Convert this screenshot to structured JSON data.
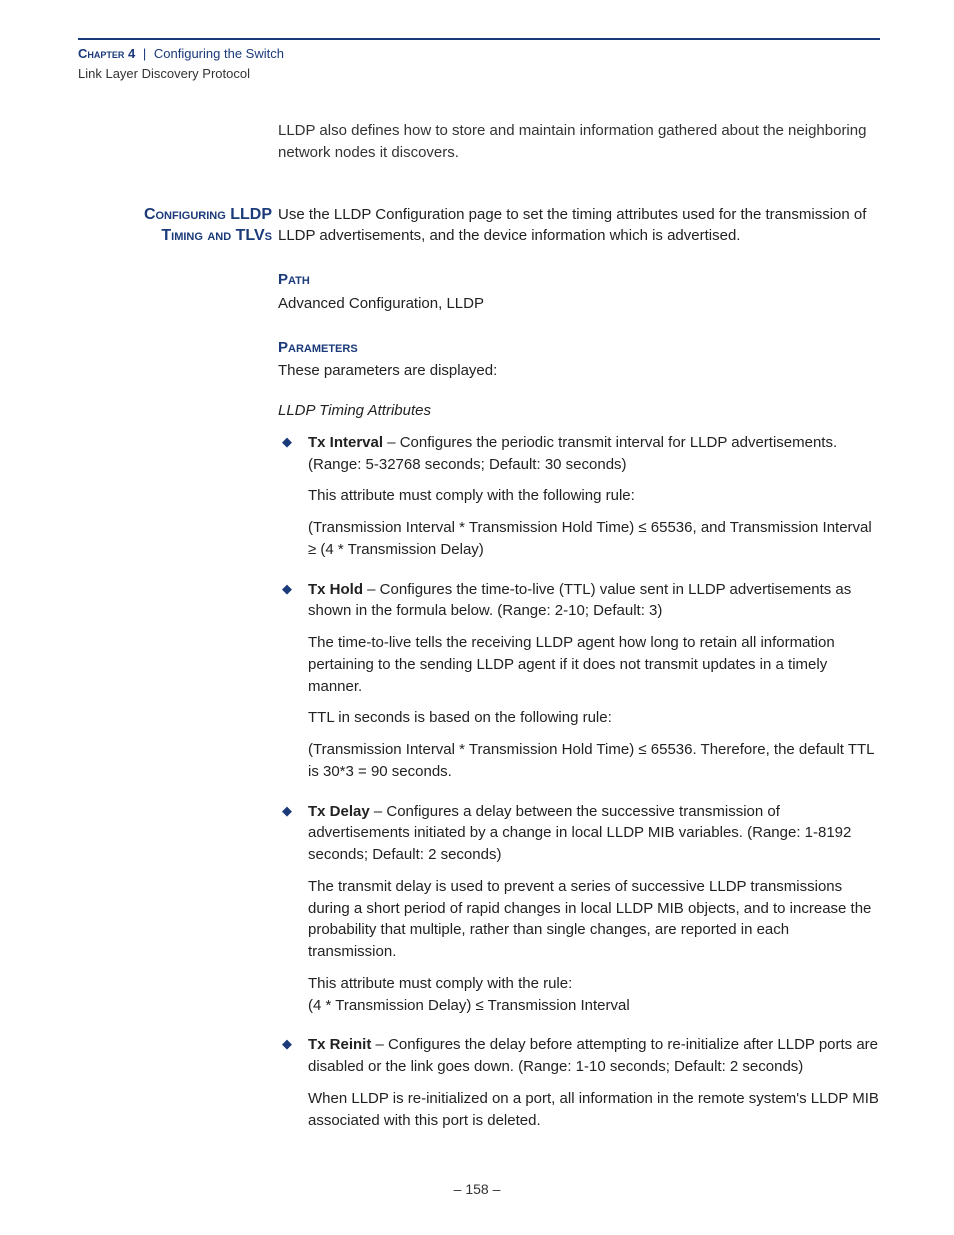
{
  "header": {
    "chapter_label": "Chapter 4",
    "separator": "|",
    "chapter_title": "Configuring the Switch",
    "section": "Link Layer Discovery Protocol"
  },
  "intro_paragraph": "LLDP also defines how to store and maintain information gathered about the neighboring network nodes it discovers.",
  "margin_heading": {
    "line1": "Configuring LLDP",
    "line2": "Timing and TLVs"
  },
  "lead_paragraph": "Use the LLDP Configuration page to set the timing attributes used for the transmission of LLDP advertisements, and the device information which is advertised.",
  "path": {
    "heading": "Path",
    "text": "Advanced Configuration, LLDP"
  },
  "parameters": {
    "heading": "Parameters",
    "intro": "These parameters are displayed:",
    "group_title": "LLDP Timing Attributes",
    "items": [
      {
        "term": "Tx Interval",
        "desc": " – Configures the periodic transmit interval for LLDP advertisements. (Range: 5-32768 seconds; Default: 30 seconds)",
        "subparas": [
          "This attribute must comply with the following rule:",
          "(Transmission Interval * Transmission Hold Time) ≤ 65536, and Transmission Interval ≥ (4 * Transmission Delay)"
        ]
      },
      {
        "term": "Tx Hold",
        "desc": " – Configures the time-to-live (TTL) value sent in LLDP advertisements as shown in the formula below. (Range: 2-10; Default: 3)",
        "subparas": [
          "The time-to-live tells the receiving LLDP agent how long to retain all information pertaining to the sending LLDP agent if it does not transmit updates in a timely manner.",
          "TTL in seconds is based on the following rule:",
          "(Transmission Interval * Transmission Hold Time) ≤ 65536. Therefore, the default TTL is 30*3 = 90 seconds."
        ]
      },
      {
        "term": "Tx Delay",
        "desc": " – Configures a delay between the successive transmission of advertisements initiated by a change in local LLDP MIB variables. (Range: 1-8192 seconds; Default: 2 seconds)",
        "subparas": [
          "The transmit delay is used to prevent a series of successive LLDP transmissions during a short period of rapid changes in local LLDP MIB objects, and to increase the probability that multiple, rather than single changes, are reported in each transmission.",
          "This attribute must comply with the rule:\n(4 * Transmission Delay) ≤ Transmission Interval"
        ]
      },
      {
        "term": "Tx Reinit",
        "desc": " – Configures the delay before attempting to re-initialize after LLDP ports are disabled or the link goes down. (Range: 1-10 seconds; Default: 2 seconds)",
        "subparas": [
          "When LLDP is re-initialized on a port, all information in the remote system's LLDP MIB associated with this port is deleted."
        ]
      }
    ]
  },
  "footer": {
    "page_number": "–  158  –"
  }
}
